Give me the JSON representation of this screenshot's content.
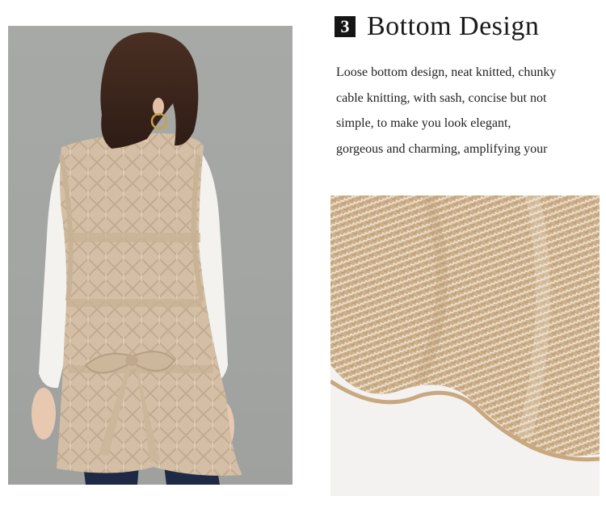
{
  "section": {
    "number": "3",
    "title": "Bottom Design",
    "description_lines": [
      "Loose bottom design, neat knitted, chunky",
      "cable knitting, with sash, concise but not",
      "simple, to make you look elegant,",
      "gorgeous and charming, amplifying your"
    ]
  },
  "images": {
    "model_photo": "model-back-view-vest-photo",
    "fabric_closeup": "knit-fabric-closeup-photo"
  },
  "colors": {
    "photo_background": "#a5a7a5",
    "knit_beige": "#d5bd9c",
    "badge": "#151515"
  }
}
